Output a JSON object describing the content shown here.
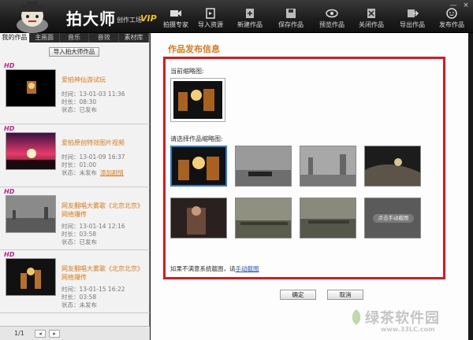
{
  "header": {
    "brand": "拍大师",
    "brand_sub": "创作工场",
    "vip": "VIP",
    "tools": [
      {
        "label": "拍摄专家",
        "icon": "camera-icon"
      },
      {
        "label": "导入资源",
        "icon": "import-icon"
      },
      {
        "label": "新建作品",
        "icon": "new-doc-icon"
      },
      {
        "label": "保存作品",
        "icon": "save-icon"
      },
      {
        "label": "预览作品",
        "icon": "eye-icon"
      },
      {
        "label": "关闭作品",
        "icon": "close-doc-icon"
      },
      {
        "label": "导出作品",
        "icon": "export-icon"
      },
      {
        "label": "发布作品",
        "icon": "publish-icon"
      }
    ],
    "window": {
      "minimize": "—",
      "close": "×"
    }
  },
  "left": {
    "tabs": [
      "我的作品",
      "主画面",
      "音乐",
      "音效",
      "素材库"
    ],
    "import_button": "导入拍大师作品",
    "works": [
      {
        "badge": "HD",
        "title": "爱拍神仙游试玩",
        "time_label": "时间：",
        "time": "13-01-03 11:36",
        "duration_label": "时长：",
        "duration": "08:30",
        "status_label": "状态：",
        "status": "已发布",
        "link": ""
      },
      {
        "badge": "HD",
        "title": "爱拍原创特效图片视频",
        "time_label": "时间：",
        "time": "13-01-09 16:37",
        "duration_label": "时长：",
        "duration": "01:00",
        "status_label": "状态：",
        "status": "未发布",
        "link": "添加剧情"
      },
      {
        "badge": "HD",
        "title": "网友翻唱大雾歌《北京北京》网络爆传",
        "time_label": "时间：",
        "time": "13-01-14 12:16",
        "duration_label": "时长：",
        "duration": "03:58",
        "status_label": "状态：",
        "status": "已发布",
        "link": ""
      },
      {
        "badge": "HD",
        "title": "网友翻唱大雾歌《北京北京》网络爆传",
        "time_label": "时间：",
        "time": "13-01-15 16:22",
        "duration_label": "时长：",
        "duration": "03:58",
        "status_label": "状态：",
        "status": "未发布",
        "link": ""
      }
    ],
    "pager": {
      "text": "1/1",
      "prev": "◂",
      "next": "▸"
    }
  },
  "right": {
    "title": "作品发布信息",
    "current_label": "当前缩略图:",
    "choose_label": "请选择作品缩略图:",
    "manual_capture": "点击手动截图",
    "hint_prefix": "如果不满意系统截图，请",
    "hint_link": "手动截图",
    "ok": "确定",
    "cancel": "取消"
  },
  "watermark": {
    "name": "绿茶软件园",
    "url": "www.33LC.com"
  },
  "colors": {
    "accent_orange": "#d97b1a",
    "highlight_red": "#e0171b",
    "selected_blue": "#2a7fd4"
  }
}
